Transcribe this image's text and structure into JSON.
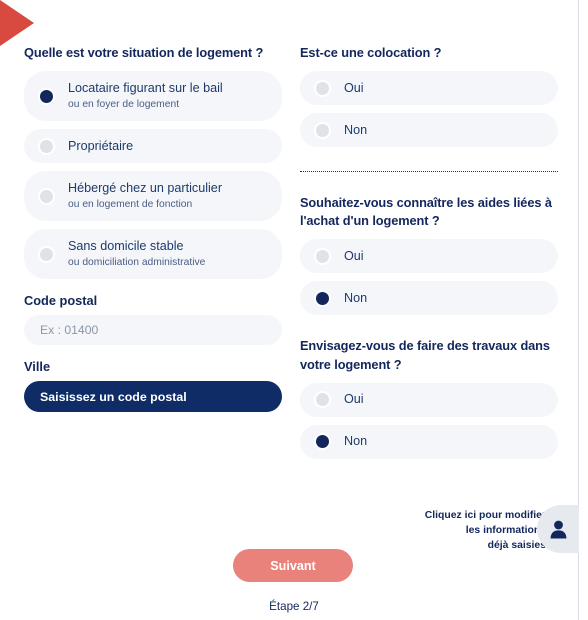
{
  "decor": {
    "arrow_icon": "triangle-right-icon",
    "arrow_color": "#d8493f"
  },
  "left_column": {
    "question": "Quelle est votre situation de logement ?",
    "options": [
      {
        "label": "Locataire figurant sur le bail",
        "sublabel": "ou en foyer de logement",
        "selected": true
      },
      {
        "label": "Propriétaire",
        "sublabel": "",
        "selected": false
      },
      {
        "label": "Hébergé chez un particulier",
        "sublabel": "ou en logement de fonction",
        "selected": false
      },
      {
        "label": "Sans domicile stable",
        "sublabel": "ou domiciliation administrative",
        "selected": false
      }
    ],
    "postal_label": "Code postal",
    "postal_placeholder": "Ex : 01400",
    "postal_value": "",
    "city_label": "Ville",
    "city_button": "Saisissez un code postal"
  },
  "right_column": {
    "colocation": {
      "question": "Est-ce une colocation ?",
      "options": [
        {
          "label": "Oui",
          "selected": false
        },
        {
          "label": "Non",
          "selected": false
        }
      ]
    },
    "aides": {
      "question": "Souhaitez-vous connaître les aides liées à l'achat d'un logement ?",
      "options": [
        {
          "label": "Oui",
          "selected": false
        },
        {
          "label": "Non",
          "selected": true
        }
      ]
    },
    "travaux": {
      "question": "Envisagez-vous de faire des travaux dans votre logement ?",
      "options": [
        {
          "label": "Oui",
          "selected": false
        },
        {
          "label": "Non",
          "selected": true
        }
      ]
    }
  },
  "footer": {
    "edit_link_line1": "Cliquez ici pour modifier",
    "edit_link_line2": "les informations",
    "edit_link_line3": "déjà saisies",
    "person_icon": "person-icon",
    "next_button": "Suivant",
    "step_text": "Étape 2/7"
  },
  "colors": {
    "navy": "#13275c",
    "pill_bg": "#f4f6f9",
    "radio_off": "#dfe3e8",
    "next_btn": "#e8827b",
    "accent_red": "#d8493f"
  }
}
